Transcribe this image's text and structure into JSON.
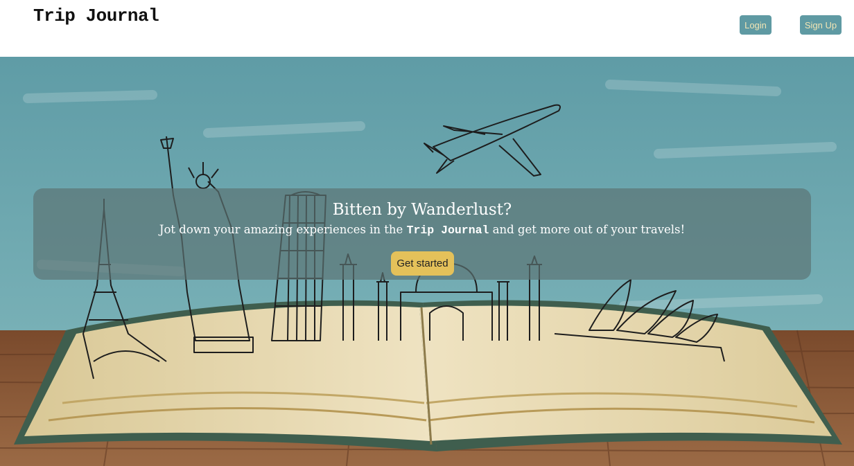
{
  "navbar": {
    "brand": "Trip Journal",
    "login_label": "Login",
    "signup_label": "Sign Up"
  },
  "hero": {
    "title": "Bitten by Wanderlust?",
    "subtitle_before": "Jot down your amazing experiences in the ",
    "subtitle_brand": "Trip Journal",
    "subtitle_after": " and get more out of your travels!",
    "cta_label": "Get started"
  },
  "colors": {
    "nav_button_bg": "#5f9aa3",
    "nav_button_text": "#f3e6b5",
    "cta_bg": "#e4c15a",
    "chalkboard": "#6ba3ac",
    "wood": "#8a5a3a",
    "book_page": "#e9dcb8"
  },
  "icons": [
    "airplane-icon",
    "eiffel-tower-icon",
    "statue-of-liberty-icon",
    "leaning-tower-icon",
    "taj-mahal-icon",
    "opera-house-icon",
    "open-book-illustration"
  ]
}
